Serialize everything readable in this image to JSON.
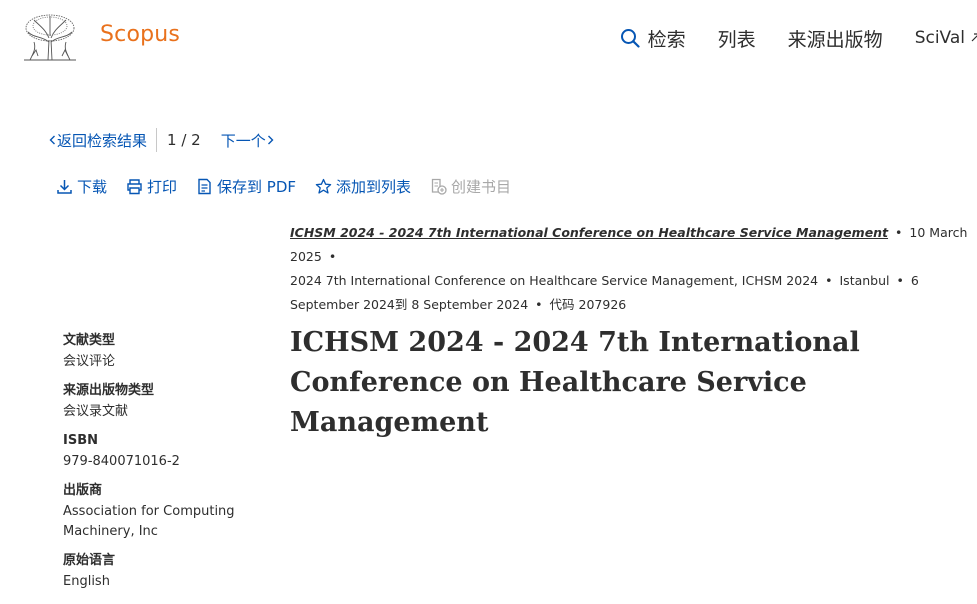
{
  "header": {
    "brand": "Scopus",
    "nav": {
      "search": "检索",
      "lists": "列表",
      "sources": "来源出版物",
      "scival": "SciVal"
    }
  },
  "pager": {
    "back": "返回检索结果",
    "count": "1 / 2",
    "next": "下一个"
  },
  "toolbar": {
    "download": "下载",
    "print": "打印",
    "save_pdf": "保存到 PDF",
    "add_list": "添加到列表",
    "create_bib": "创建书目"
  },
  "source": {
    "title": "ICHSM 2024 - 2024 7th International Conference on Healthcare Service Management",
    "date": "10 March 2025",
    "conference": "2024 7th International Conference on Healthcare Service Management, ICHSM 2024",
    "location": "Istanbul",
    "dates": "6 September 2024到 8 September 2024",
    "code": "代码 207926"
  },
  "meta": [
    {
      "label": "文献类型",
      "value": "会议评论"
    },
    {
      "label": "来源出版物类型",
      "value": "会议录文献"
    },
    {
      "label": "ISBN",
      "value": "979-840071016-2"
    },
    {
      "label": "出版商",
      "value": "Association for Computing Machinery, Inc"
    },
    {
      "label": "原始语言",
      "value": "English"
    }
  ],
  "main": {
    "title": "ICHSM 2024 - 2024 7th International Conference on Healthcare Service Management"
  },
  "colors": {
    "brand": "#e9711c",
    "link": "#0656b4",
    "text": "#2e2e2e",
    "disabled": "#a8a8a8"
  }
}
